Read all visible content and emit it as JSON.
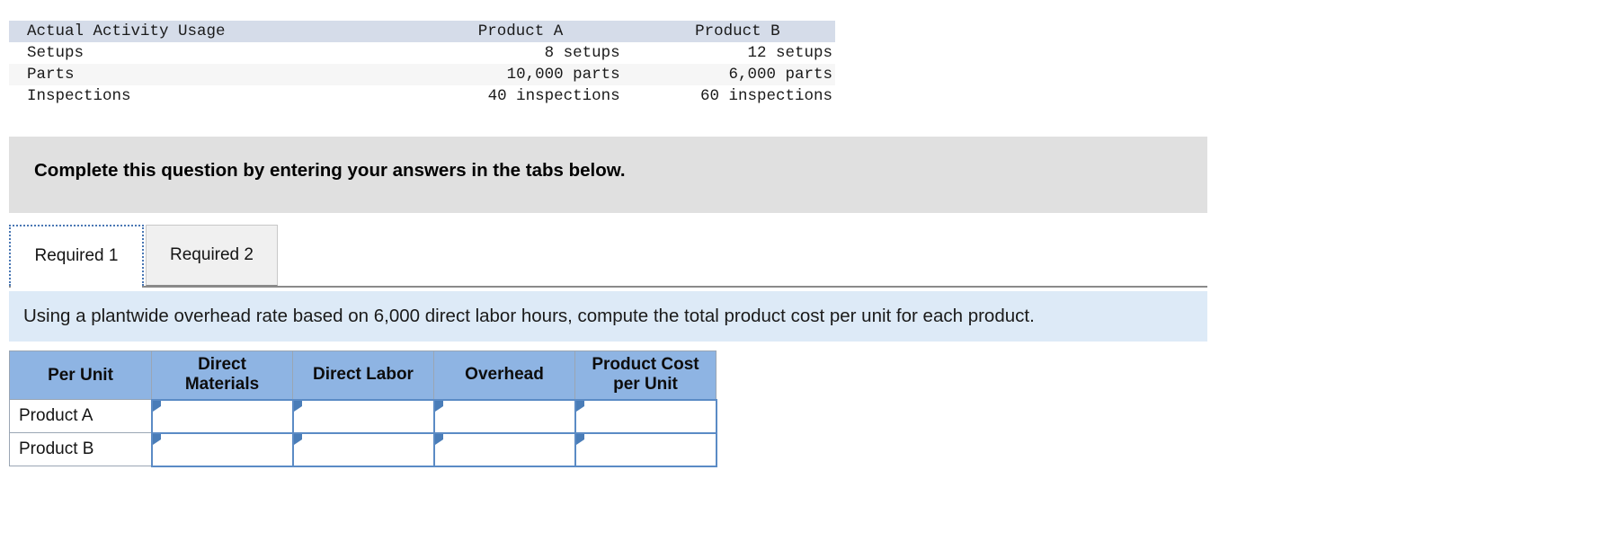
{
  "usage_table": {
    "headers": [
      "Actual Activity Usage",
      "Product A",
      "Product B"
    ],
    "rows": [
      {
        "label": "Setups",
        "product_a": "8 setups",
        "product_b": "12 setups"
      },
      {
        "label": "Parts",
        "product_a": "10,000 parts",
        "product_b": "6,000 parts"
      },
      {
        "label": "Inspections",
        "product_a": "40 inspections",
        "product_b": "60 inspections"
      }
    ]
  },
  "instruction_banner": {
    "text": "Complete this question by entering your answers in the tabs below."
  },
  "tabs": [
    {
      "label": "Required 1",
      "selected": true
    },
    {
      "label": "Required 2",
      "selected": false
    }
  ],
  "requirement_bar": {
    "text": "Using a plantwide overhead rate based on 6,000 direct labor hours, compute the total product cost per unit for each product."
  },
  "answer_table": {
    "headers": [
      "Per Unit",
      "Direct Materials",
      "Direct Labor",
      "Overhead",
      "Product Cost per Unit"
    ],
    "header_lines": [
      [
        "Per Unit"
      ],
      [
        "Direct",
        "Materials"
      ],
      [
        "Direct Labor"
      ],
      [
        "Overhead"
      ],
      [
        "Product Cost",
        "per Unit"
      ]
    ],
    "rows": [
      {
        "label": "Product A",
        "direct_materials": "",
        "direct_labor": "",
        "overhead": "",
        "product_cost_per_unit": ""
      },
      {
        "label": "Product B",
        "direct_materials": "",
        "direct_labor": "",
        "overhead": "",
        "product_cost_per_unit": ""
      }
    ]
  },
  "colors": {
    "usage_header_bg": "#d5dce9",
    "usage_alt_row_bg": "#f6f6f6",
    "gray_banner_bg": "#e0e0e0",
    "blue_bar_bg": "#ddeaf7",
    "answer_header_bg": "#8eb4e3",
    "input_border": "#5b8bc5",
    "tab_focus_border": "#4a77b4"
  }
}
